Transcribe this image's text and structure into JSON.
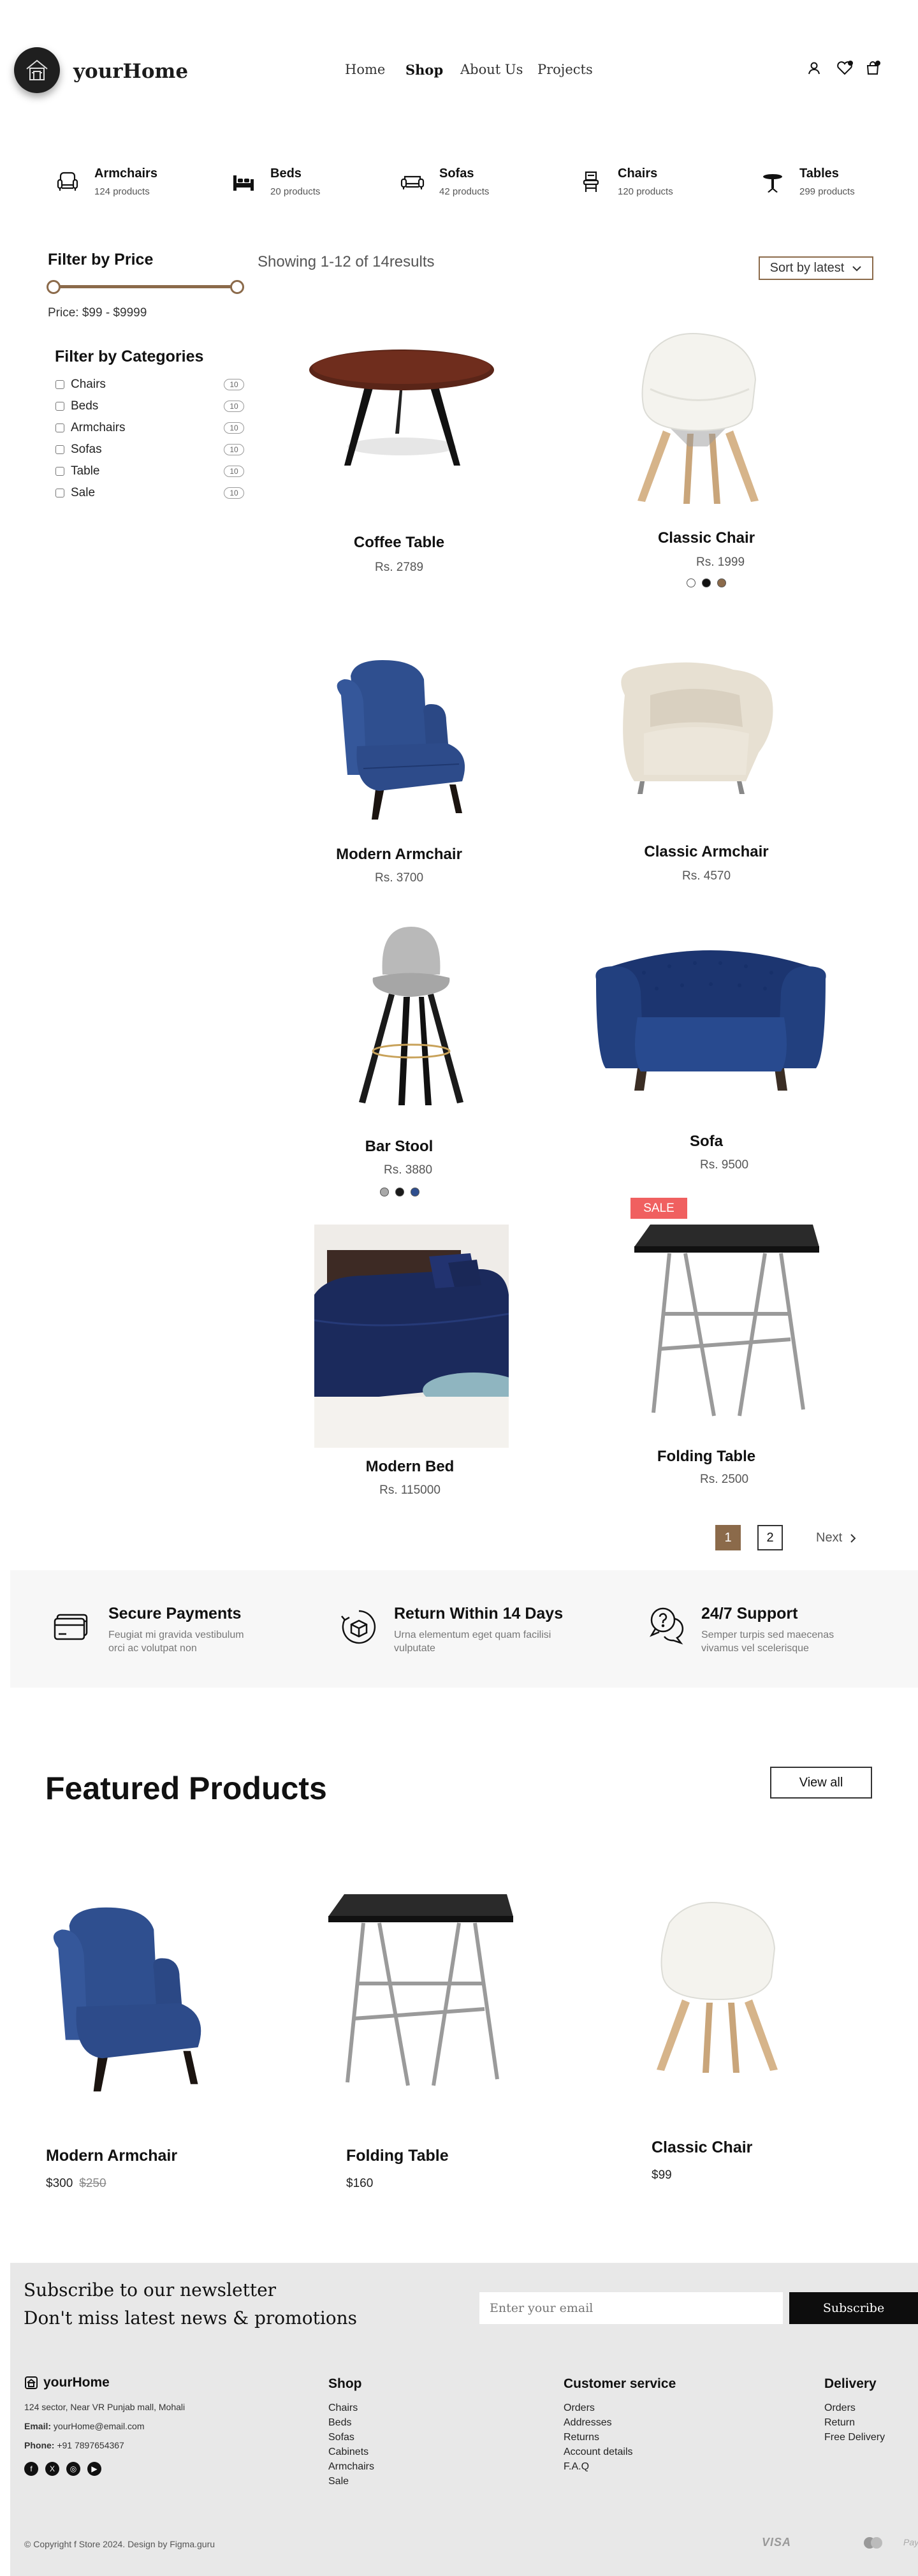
{
  "header": {
    "brand": "yourHome",
    "nav": [
      "Home",
      "Shop",
      "About Us",
      "Projects"
    ]
  },
  "categories": [
    {
      "name": "Armchairs",
      "count": "124 products",
      "icon": "armchair-icon"
    },
    {
      "name": "Beds",
      "count": "20 products",
      "icon": "bed-icon"
    },
    {
      "name": "Sofas",
      "count": "42 products",
      "icon": "sofa-icon"
    },
    {
      "name": "Chairs",
      "count": "120 products",
      "icon": "chair-icon"
    },
    {
      "name": "Tables",
      "count": "299 products",
      "icon": "table-icon"
    }
  ],
  "filters": {
    "price_title": "Filter by Price",
    "price_range": "Price: $99 - $9999",
    "categories_title": "Filter by Categories",
    "category_list": [
      {
        "label": "Chairs",
        "count": "10"
      },
      {
        "label": "Beds",
        "count": "10"
      },
      {
        "label": "Armchairs",
        "count": "10"
      },
      {
        "label": "Sofas",
        "count": "10"
      },
      {
        "label": "Table",
        "count": "10"
      },
      {
        "label": "Sale",
        "count": "10"
      }
    ]
  },
  "listing": {
    "showing": "Showing 1-12 of 14results",
    "sort_label": "Sort by latest"
  },
  "products": [
    {
      "name": "Coffee Table",
      "price": "Rs. 2789"
    },
    {
      "name": "Classic Chair",
      "price": "Rs. 1999"
    },
    {
      "name": "Modern Armchair",
      "price": "Rs. 3700"
    },
    {
      "name": "Classic Armchair",
      "price": "Rs. 4570"
    },
    {
      "name": "Bar Stool",
      "price": "Rs. 3880"
    },
    {
      "name": "Sofa",
      "price": "Rs. 9500"
    },
    {
      "name": "Modern Bed",
      "price": "Rs. 115000"
    },
    {
      "name": "Folding Table",
      "price": "Rs. 2500",
      "badge": "SALE"
    }
  ],
  "pagination": {
    "pages": [
      "1",
      "2"
    ],
    "next": "Next"
  },
  "features": [
    {
      "title": "Secure Payments",
      "desc1": "Feugiat mi gravida vestibulum",
      "desc2": "orci ac volutpat non"
    },
    {
      "title": "Return Within 14 Days",
      "desc1": "Urna elementum eget quam facilisi",
      "desc2": "vulputate"
    },
    {
      "title": "24/7 Support",
      "desc1": "Semper turpis sed maecenas",
      "desc2": "vivamus vel scelerisque"
    }
  ],
  "featured": {
    "title": "Featured Products",
    "view_all": "View all",
    "items": [
      {
        "name": "Modern Armchair",
        "price": "$300",
        "old_price": "$250"
      },
      {
        "name": "Folding Table",
        "price": "$160"
      },
      {
        "name": "Classic Chair",
        "price": "$99"
      }
    ]
  },
  "newsletter": {
    "line1": "Subscribe to our newsletter",
    "line2": "Don't miss latest news & promotions",
    "placeholder": "Enter your email",
    "button": "Subscribe"
  },
  "footer": {
    "brand": "yourHome",
    "address": "124 sector, Near VR Punjab mall, Mohali",
    "email_label": "Email:",
    "email": "yourHome@email.com",
    "phone_label": "Phone:",
    "phone": "+91 7897654367",
    "columns": [
      {
        "title": "Shop",
        "items": [
          "Chairs",
          "Beds",
          "Sofas",
          "Cabinets",
          "Armchairs",
          "Sale"
        ]
      },
      {
        "title": "Customer service",
        "items": [
          "Orders",
          "Addresses",
          "Returns",
          "Account details",
          "F.A.Q"
        ]
      },
      {
        "title": "Delivery",
        "items": [
          "Orders",
          "Return",
          "Free Delivery"
        ]
      }
    ],
    "copyright": "© Copyright f Store 2024. Design by Figma.guru",
    "payments": [
      "VISA",
      "PayPal"
    ]
  },
  "colors": {
    "accent": "#8b6a4a",
    "sale": "#f06060",
    "footer_bg": "#e8e8e8"
  }
}
